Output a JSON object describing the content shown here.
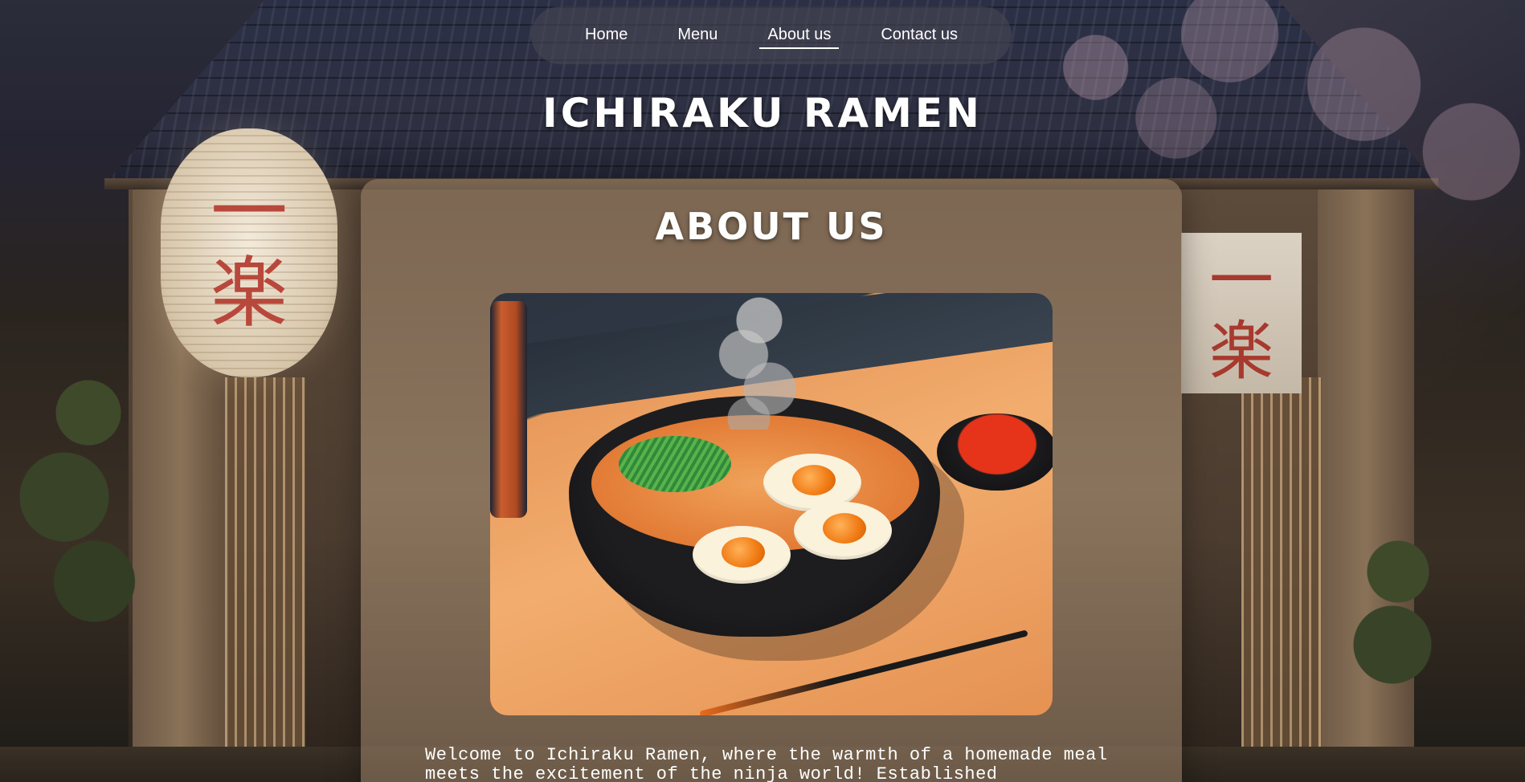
{
  "nav": {
    "items": [
      {
        "label": "Home",
        "active": false
      },
      {
        "label": "Menu",
        "active": false
      },
      {
        "label": "About us",
        "active": true
      },
      {
        "label": "Contact us",
        "active": false
      }
    ]
  },
  "site": {
    "title": "Ichiraku Ramen"
  },
  "background": {
    "lantern_glyphs": [
      "一",
      "楽"
    ],
    "curtain_glyphs": [
      "一",
      "楽"
    ]
  },
  "about": {
    "heading": "About us",
    "image_icon": "ramen-bowl-illustration",
    "intro": "Welcome to Ichiraku Ramen, where the warmth of a homemade meal meets the excitement of the ninja world! Established"
  },
  "colors": {
    "nav_bg": "#46465290",
    "text": "#ffffff",
    "panel": "#9b8269"
  }
}
